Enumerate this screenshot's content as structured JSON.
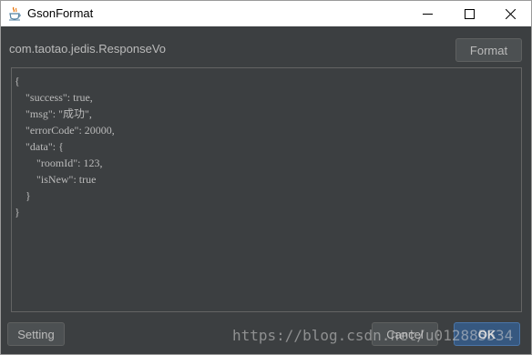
{
  "window": {
    "title": "GsonFormat"
  },
  "header": {
    "class_name": "com.taotao.jedis.ResponseVo",
    "format_label": "Format"
  },
  "editor": {
    "lines": [
      "{",
      "    \"success\": true,",
      "    \"msg\": \"成功\",",
      "    \"errorCode\": 20000,",
      "    \"data\": {",
      "        \"roomId\": 123,",
      "        \"isNew\": true",
      "    }",
      "}"
    ]
  },
  "footer": {
    "setting_label": "Setting",
    "cancel_label": "Cancel",
    "ok_label": "OK"
  },
  "watermark": {
    "text": "https://blog.csdn.net/u012885534"
  },
  "colors": {
    "background": "#3c3f41",
    "text": "#bbbbbb",
    "button": "#4c5052",
    "ok_button": "#365880",
    "titlebar": "#ffffff"
  },
  "icons": {
    "app": "java-cup-icon",
    "minimize": "minimize-icon",
    "maximize": "maximize-icon",
    "close": "close-icon"
  }
}
